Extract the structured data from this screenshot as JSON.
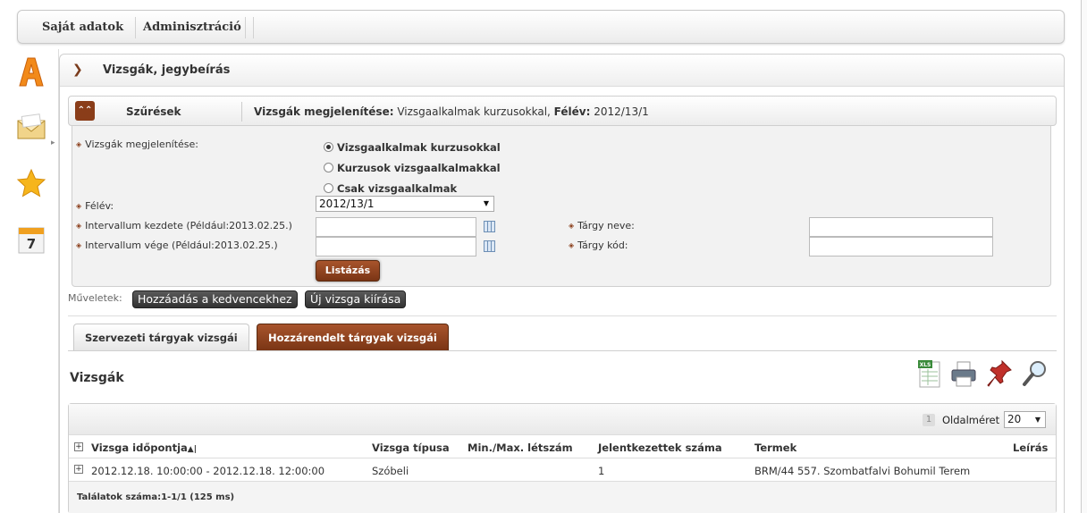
{
  "topmenu": {
    "item1": "Saját adatok",
    "item2": "Adminisztráció"
  },
  "sidebar": {
    "icons": [
      "letter-a-icon",
      "envelope-icon",
      "star-icon",
      "calendar-icon"
    ],
    "calendar_day": "7"
  },
  "main": {
    "title": "Vizsgák, jegybeírás"
  },
  "filter": {
    "head_label": "Szűrések",
    "summary_key1": "Vizsgák megjelenítése:",
    "summary_val1": " Vizsgaalkalmak kurzusokkal, ",
    "summary_key2": "Félév:",
    "summary_val2": " 2012/13/1",
    "display_label": "Vizsgák megjelenítése:",
    "radio1": "Vizsgaalkalmak kurzusokkal",
    "radio2": "Kurzusok vizsgaalkalmakkal",
    "radio3": "Csak vizsgaalkalmak",
    "semester_label": "Félév:",
    "semester_value": "2012/13/1",
    "start_label": "Intervallum kezdete (Például:2013.02.25.)",
    "end_label": "Intervallum vége (Például:2013.02.25.)",
    "subject_name_label": "Tárgy neve:",
    "subject_code_label": "Tárgy kód:",
    "list_button": "Listázás"
  },
  "operations": {
    "label": "Műveletek:",
    "btn1": "Hozzáadás a kedvencekhez",
    "btn2": "Új vizsga kiírása"
  },
  "tabs": {
    "tab1": "Szervezeti tárgyak vizsgái",
    "tab2": "Hozzárendelt tárgyak vizsgái"
  },
  "exams": {
    "title": "Vizsgák",
    "tools": [
      "excel-export-icon",
      "print-icon",
      "pin-icon",
      "search-icon"
    ],
    "page_number": "1",
    "page_size_label": "Oldalméret",
    "page_size": "20",
    "columns": [
      "Vizsga időpontja",
      "Vizsga típusa",
      "Min./Max. létszám",
      "Jelentkezettek száma",
      "Termek",
      "Leírás"
    ],
    "sort_indicator": "▲|",
    "rows": [
      {
        "time": "2012.12.18. 10:00:00 - 2012.12.18. 12:00:00",
        "type": "Szóbeli",
        "minmax": "",
        "registered": "1",
        "room": "BRM/44 557. Szombatfalvi Bohumil Terem",
        "description": ""
      }
    ],
    "footer": "Találatok száma:1-1/1 (125 ms)"
  },
  "colors": {
    "brown_accent": "#8a3d19",
    "orange_a": "#f28a1a"
  }
}
